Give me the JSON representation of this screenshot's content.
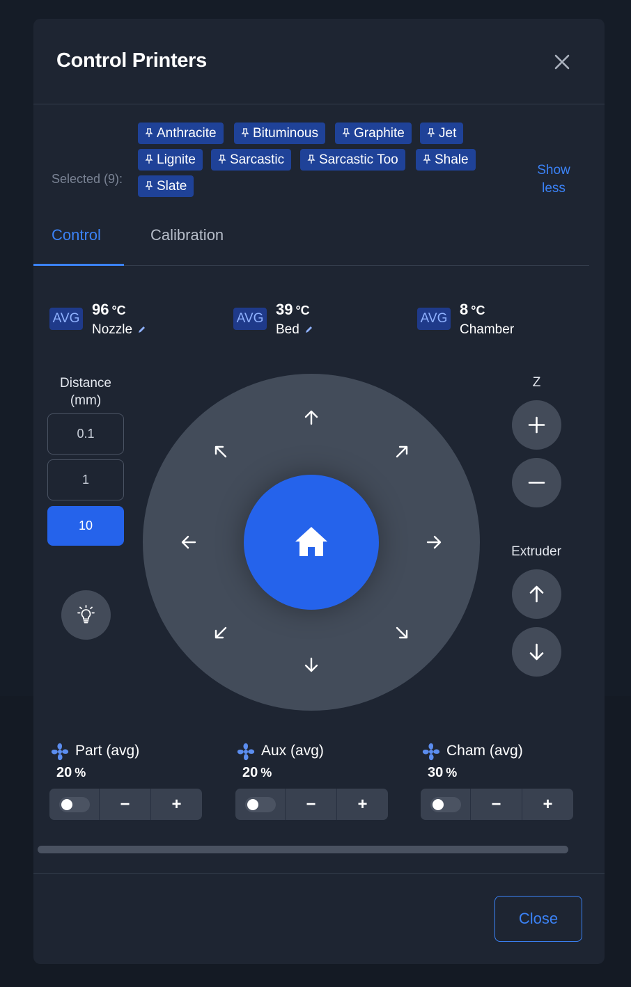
{
  "dialog": {
    "title": "Control Printers",
    "close_label": "Close"
  },
  "selection": {
    "label": "Selected (9):",
    "printers": [
      "Anthracite",
      "Bituminous",
      "Graphite",
      "Jet",
      "Lignite",
      "Sarcastic",
      "Sarcastic Too",
      "Shale",
      "Slate"
    ],
    "toggle_label_line1": "Show",
    "toggle_label_line2": "less"
  },
  "tabs": [
    {
      "label": "Control",
      "active": true
    },
    {
      "label": "Calibration",
      "active": false
    }
  ],
  "temperatures": [
    {
      "badge": "AVG",
      "value": "96",
      "unit": "°C",
      "name": "Nozzle",
      "editable": true
    },
    {
      "badge": "AVG",
      "value": "39",
      "unit": "°C",
      "name": "Bed",
      "editable": true
    },
    {
      "badge": "AVG",
      "value": "8",
      "unit": "°C",
      "name": "Chamber",
      "editable": false
    }
  ],
  "distance": {
    "label_line1": "Distance",
    "label_line2": "(mm)",
    "options": [
      "0.1",
      "1",
      "10"
    ],
    "selected": "10"
  },
  "axes": {
    "z_label": "Z",
    "extruder_label": "Extruder"
  },
  "fans": [
    {
      "name": "Part (avg)",
      "value": "20",
      "unit": "%"
    },
    {
      "name": "Aux (avg)",
      "value": "20",
      "unit": "%"
    },
    {
      "name": "Cham (avg)",
      "value": "30",
      "unit": "%"
    }
  ],
  "fan_controls": {
    "minus": "−",
    "plus": "+"
  },
  "icons": [
    "close-icon",
    "pin-icon",
    "pencil-icon",
    "lightbulb-icon",
    "home-icon",
    "arrow-icons",
    "plus-icon",
    "minus-icon",
    "fan-icon"
  ],
  "colors": {
    "accent": "#3b82f6",
    "primary": "#2563eb",
    "badge_bg": "#1f3a8a",
    "chip_bg": "#1f4298"
  }
}
